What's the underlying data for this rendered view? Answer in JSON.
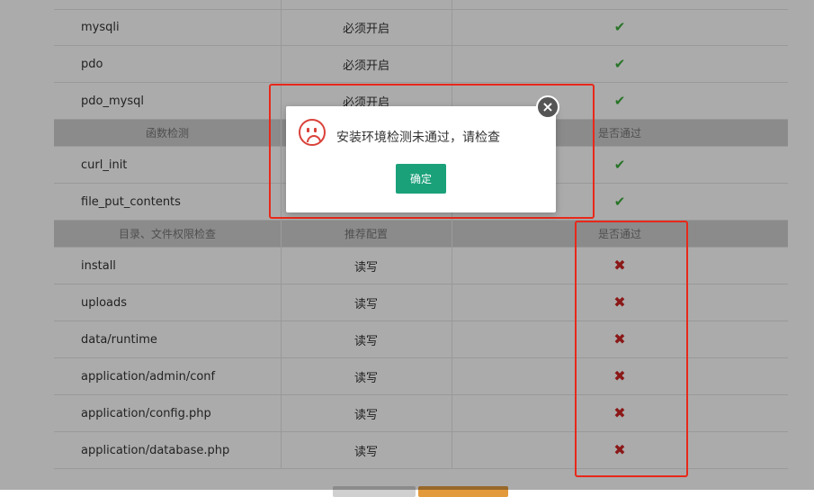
{
  "headers": {
    "func_check": "函数检测",
    "passed": "是否通过",
    "dir_check": "目录、文件权限检查",
    "recommended": "推荐配置",
    "passed2": "是否通过"
  },
  "rows_top": [
    {
      "name": "mysqli",
      "req": "必须开启",
      "status": "✔"
    },
    {
      "name": "pdo",
      "req": "必须开启",
      "status": "✔"
    },
    {
      "name": "pdo_mysql",
      "req": "必须开启",
      "status": "✔"
    }
  ],
  "rows_func": [
    {
      "name": "curl_init",
      "status": "✔"
    },
    {
      "name": "file_put_contents",
      "status": "✔"
    }
  ],
  "rows_dir": [
    {
      "name": "install",
      "req": "读写",
      "status": "✖"
    },
    {
      "name": "uploads",
      "req": "读写",
      "status": "✖"
    },
    {
      "name": "data/runtime",
      "req": "读写",
      "status": "✖"
    },
    {
      "name": "application/admin/conf",
      "req": "读写",
      "status": "✖"
    },
    {
      "name": "application/config.php",
      "req": "读写",
      "status": "✖"
    },
    {
      "name": "application/database.php",
      "req": "读写",
      "status": "✖"
    }
  ],
  "dialog": {
    "message": "安装环境检测未通过，请检查",
    "ok_label": "确定",
    "close_glyph": "×",
    "icon": "sad-face-icon"
  },
  "colors": {
    "accent": "#1aa17a",
    "ok": "#3cae3c",
    "fail": "#d02424",
    "highlight": "#e8281a"
  }
}
